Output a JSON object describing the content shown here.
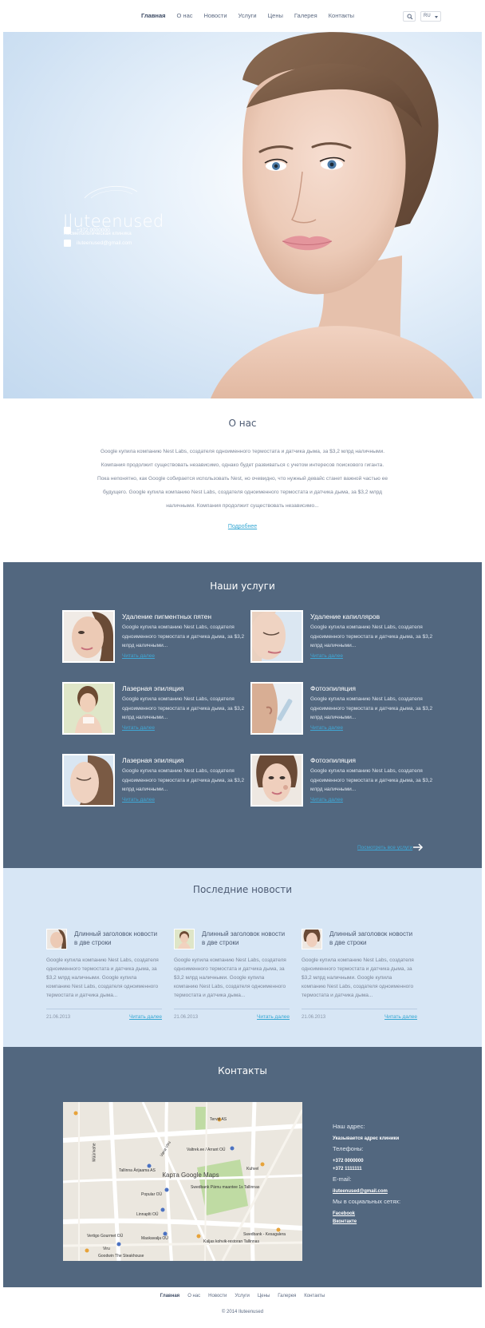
{
  "header": {
    "nav": [
      "Главная",
      "О нас",
      "Новости",
      "Услуги",
      "Цены",
      "Галерея",
      "Контакты"
    ],
    "lang": "RU"
  },
  "hero": {
    "brand": "Iluteenused",
    "subtitle": "Косметологическая клиника",
    "phone": "+372 0000000",
    "email": "iluteenused@gmail.com"
  },
  "about": {
    "title": "О нас",
    "text": "Google купила компанию Nest Labs, создателя одноименного термостата и датчика дыма, за $3,2 млрд наличными. Компания продолжит существовать независимо, однако будет развиваться с учетом интересов поискового гиганта. Пока непонятно, как Google собирается использовать Nest, но очевидно, что нужный девайс станет важной частью ее будущего. Google купила компанию Nest Labs, создателя одноименного термостата и датчика дыма, за $3,2 млрд наличными. Компания продолжит существовать независимо...",
    "more": "Подробнее"
  },
  "services": {
    "title": "Наши услуги",
    "items": [
      {
        "name": "Удаление пигментных пятен",
        "desc": "Google купила компанию Nest Labs, создателя одноименного термостата и датчика дыма, за $3,2 млрд наличными...",
        "more": "Читать далее"
      },
      {
        "name": "Удаление капилляров",
        "desc": "Google купила компанию Nest Labs, создателя одноименного термостата и датчика дыма, за $3,2 млрд наличными...",
        "more": "Читать далее"
      },
      {
        "name": "Лазерная эпиляция",
        "desc": "Google купила компанию Nest Labs, создателя одноименного термостата и датчика дыма, за $3,2 млрд наличными...",
        "more": "Читать далее"
      },
      {
        "name": "Фотоэпиляция",
        "desc": "Google купила компанию Nest Labs, создателя одноименного термостата и датчика дыма, за $3,2 млрд наличными...",
        "more": "Читать далее"
      },
      {
        "name": "Лазерная эпиляция",
        "desc": "Google купила компанию Nest Labs, создателя одноименного термостата и датчика дыма, за $3,2 млрд наличными...",
        "more": "Читать далее"
      },
      {
        "name": "Фотоэпиляция",
        "desc": "Google купила компанию Nest Labs, создателя одноименного термостата и датчика дыма, за $3,2 млрд наличными...",
        "more": "Читать далее"
      }
    ],
    "all": "Посмотреть все услуги"
  },
  "news": {
    "title": "Последние новости",
    "items": [
      {
        "title": "Длинный заголовок новости в две строки",
        "text": "Google купила компанию Nest Labs, создателя одноименного термостата и датчика дыма, за $3,2 млрд наличными. Google купила компанию Nest Labs, создателя одноименного термостата и датчика дыма...",
        "date": "21.06.2013",
        "more": "Читать далее"
      },
      {
        "title": "Длинный заголовок новости в две строки",
        "text": "Google купила компанию Nest Labs, создателя одноименного термостата и датчика дыма, за $3,2 млрд наличными. Google купила компанию Nest Labs, создателя одноименного термостата и датчика дыма...",
        "date": "21.06.2013",
        "more": "Читать далее"
      },
      {
        "title": "Длинный заголовок новости в две строки",
        "text": "Google купила компанию Nest Labs, создателя одноименного термостата и датчика дыма, за $3,2 млрд наличными. Google купила компанию Nest Labs, создателя одноименного термостата и датчика дыма...",
        "date": "21.06.2013",
        "more": "Читать далее"
      }
    ]
  },
  "contacts": {
    "title": "Контакты",
    "map_caption": "Карта Google Maps",
    "map_labels": [
      "Tervid AS",
      "Valtrek.ee / Arrant OÜ",
      "Kuhvel",
      "Tallinna Ärijaama AS",
      "Swedbank Pärnu maantee 1s Tallinnas",
      "Popular OÜ",
      "Linnaplti OÜ",
      "Vertigo Gourmet OÜ",
      "Swedbank - Kesagalera",
      "Kaljas kohvik-restoran Tallinnas",
      "Maskavalja OÜ",
      "Goodwin The Steakhouse",
      "Viru",
      "Müürivahe",
      "Vana Viru"
    ],
    "address_label": "Наш адрес:",
    "address": "Указывается адрес клиники",
    "phones_label": "Телефоны:",
    "phone1": "+372 0000000",
    "phone2": "+372 1111111",
    "email_label": "E-mail:",
    "email": "iluteenused@gmail.com",
    "social_label": "Мы в социальных сетях:",
    "facebook": "Facebook",
    "vk": "Вконтакте"
  },
  "footer": {
    "nav": [
      "Главная",
      "О нас",
      "Новости",
      "Услуги",
      "Цены",
      "Галерея",
      "Контакты"
    ],
    "copyright": "© 2014 Iluteenused"
  }
}
